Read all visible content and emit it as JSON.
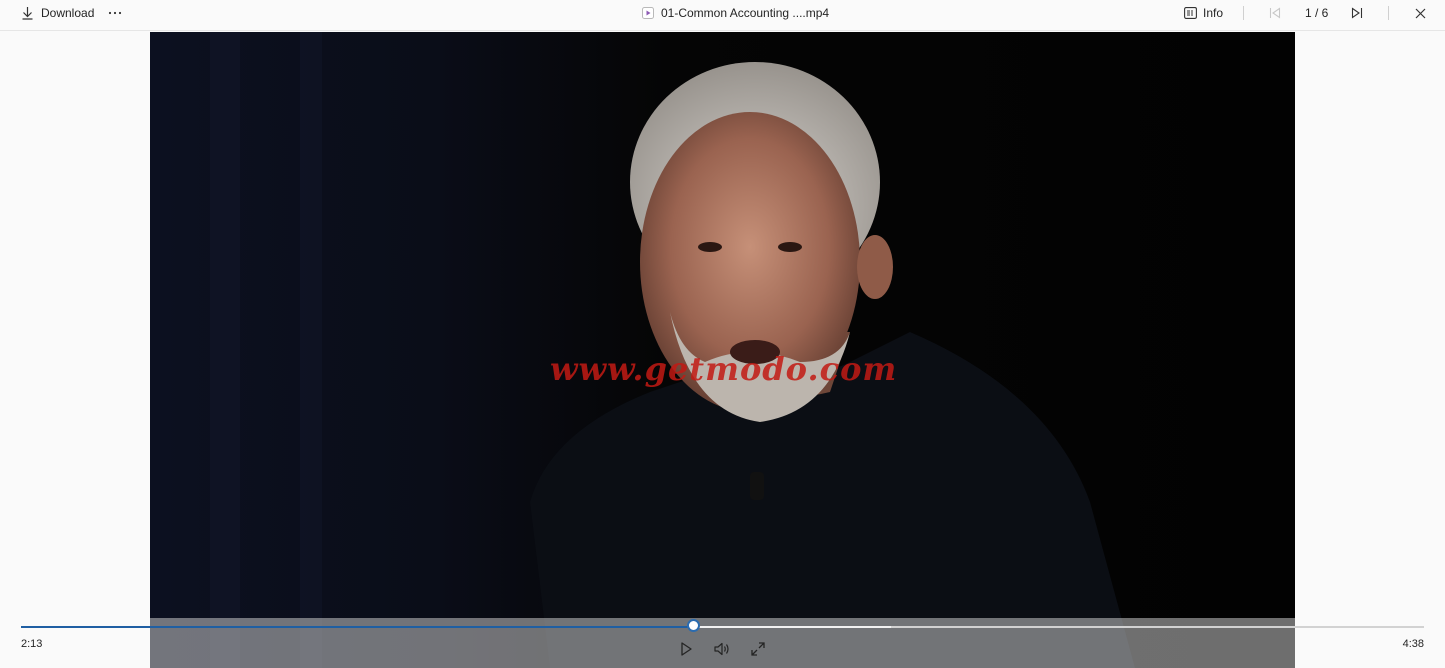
{
  "toolbar": {
    "download_label": "Download",
    "more_icon": "ellipsis-icon",
    "file_title": "01-Common Accounting ....mp4",
    "info_label": "Info",
    "page_counter": "1 / 6"
  },
  "video": {
    "watermark": "www.getmodo.com"
  },
  "player": {
    "current_time": "2:13",
    "total_time": "4:38",
    "progress": 0.48,
    "buffered": 0.62
  },
  "colors": {
    "accent": "#1f5fa3",
    "watermark": "#c21a14"
  }
}
